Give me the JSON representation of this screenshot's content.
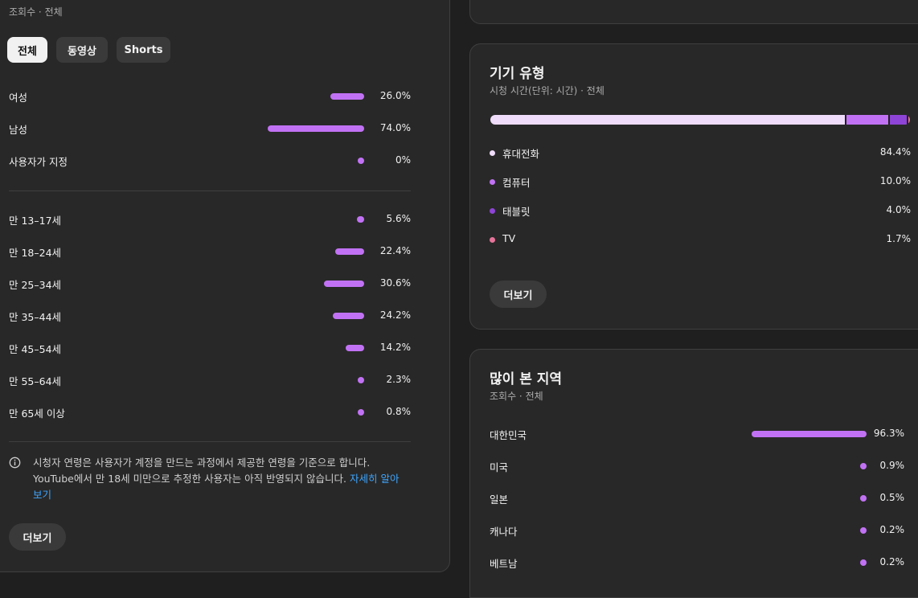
{
  "colors": {
    "bar": "#c172f4",
    "phone": "#efdcfb",
    "computer": "#c172f4",
    "tablet": "#8e44d6",
    "tv": "#e5739a"
  },
  "left": {
    "subtitle": "조회수 · 전체",
    "chips": [
      {
        "label": "전체",
        "selected": true
      },
      {
        "label": "동영상",
        "selected": false
      },
      {
        "label": "Shorts",
        "selected": false
      }
    ],
    "gender": [
      {
        "label": "여성",
        "value": "26.0%",
        "pct": 26.0
      },
      {
        "label": "남성",
        "value": "74.0%",
        "pct": 74.0
      },
      {
        "label": "사용자가 지정",
        "value": "0%",
        "pct": 0
      }
    ],
    "age": [
      {
        "label": "만 13–17세",
        "value": "5.6%",
        "pct": 5.6
      },
      {
        "label": "만 18–24세",
        "value": "22.4%",
        "pct": 22.4
      },
      {
        "label": "만 25–34세",
        "value": "30.6%",
        "pct": 30.6
      },
      {
        "label": "만 35–44세",
        "value": "24.2%",
        "pct": 24.2
      },
      {
        "label": "만 45–54세",
        "value": "14.2%",
        "pct": 14.2
      },
      {
        "label": "만 55–64세",
        "value": "2.3%",
        "pct": 2.3
      },
      {
        "label": "만 65세 이상",
        "value": "0.8%",
        "pct": 0.8
      }
    ],
    "info": {
      "line1": "시청자 연령은 사용자가 계정을 만드는 과정에서 제공한 연령을 기준으로 합니다.",
      "line2": "YouTube에서 만 18세 미만으로 추정한 사용자는 아직 반영되지 않습니다.",
      "link1": "자세히 알아",
      "link2": "보기"
    },
    "more_label": "더보기"
  },
  "device": {
    "title": "기기 유형",
    "subtitle": "시청 시간(단위: 시간) · 전체",
    "items": [
      {
        "label": "휴대전화",
        "value": "84.4%",
        "pct": 84.4,
        "color_key": "phone"
      },
      {
        "label": "컴퓨터",
        "value": "10.0%",
        "pct": 10.0,
        "color_key": "computer"
      },
      {
        "label": "태블릿",
        "value": "4.0%",
        "pct": 4.0,
        "color_key": "tablet"
      },
      {
        "label": "TV",
        "value": "1.7%",
        "pct": 1.7,
        "color_key": "tv"
      }
    ],
    "more_label": "더보기"
  },
  "region": {
    "title": "많이 본 지역",
    "subtitle": "조회수 · 전체",
    "items": [
      {
        "label": "대한민국",
        "value": "96.3%",
        "pct": 96.3
      },
      {
        "label": "미국",
        "value": "0.9%",
        "pct": 0.9
      },
      {
        "label": "일본",
        "value": "0.5%",
        "pct": 0.5
      },
      {
        "label": "캐나다",
        "value": "0.2%",
        "pct": 0.2
      },
      {
        "label": "베트남",
        "value": "0.2%",
        "pct": 0.2
      }
    ]
  }
}
